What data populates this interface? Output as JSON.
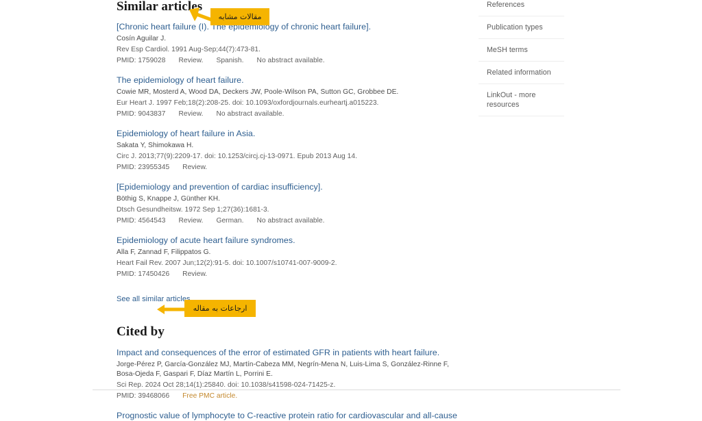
{
  "page": {
    "background": "#ffffff",
    "link_color": "#2c5d8f",
    "accent_color": "#f5b400",
    "free_article_color": "#c3872b"
  },
  "similar_articles": {
    "heading": "Similar articles",
    "see_all_label": "See all similar articles",
    "articles": [
      {
        "title": "[Chronic heart failure (I). The epidemiology of chronic heart failure].",
        "authors": "Cosín Aguilar J.",
        "citation": "Rev Esp Cardiol. 1991 Aug-Sep;44(7):473-81.",
        "pmid": "PMID: 1759028",
        "tags": [
          "Review.",
          "Spanish.",
          "No abstract available."
        ]
      },
      {
        "title": "The epidemiology of heart failure.",
        "authors": "Cowie MR, Mosterd A, Wood DA, Deckers JW, Poole-Wilson PA, Sutton GC, Grobbee DE.",
        "citation": "Eur Heart J. 1997 Feb;18(2):208-25. doi: 10.1093/oxfordjournals.eurheartj.a015223.",
        "pmid": "PMID: 9043837",
        "tags": [
          "Review.",
          "No abstract available."
        ]
      },
      {
        "title": "Epidemiology of heart failure in Asia.",
        "authors": "Sakata Y, Shimokawa H.",
        "citation": "Circ J. 2013;77(9):2209-17. doi: 10.1253/circj.cj-13-0971. Epub 2013 Aug 14.",
        "pmid": "PMID: 23955345",
        "tags": [
          "Review."
        ]
      },
      {
        "title": "[Epidemiology and prevention of cardiac insufficiency].",
        "authors": "Böthig S, Knappe J, Günther KH.",
        "citation": "Dtsch Gesundheitsw. 1972 Sep 1;27(36):1681-3.",
        "pmid": "PMID: 4564543",
        "tags": [
          "Review.",
          "German.",
          "No abstract available."
        ]
      },
      {
        "title": "Epidemiology of acute heart failure syndromes.",
        "authors": "Alla F, Zannad F, Filippatos G.",
        "citation": "Heart Fail Rev. 2007 Jun;12(2):91-5. doi: 10.1007/s10741-007-9009-2.",
        "pmid": "PMID: 17450426",
        "tags": [
          "Review."
        ]
      }
    ]
  },
  "cited_by": {
    "heading": "Cited by",
    "articles": [
      {
        "title": "Impact and consequences of the error of estimated GFR in patients with heart failure.",
        "authors": "Jorge-Pérez P, García-González MJ, Martín-Cabeza MM, Negrín-Mena N, Luis-Lima S, González-Rinne F, Bosa-Ojeda F, Gaspari F, Díaz Martín L, Porrini E.",
        "citation": "Sci Rep. 2024 Oct 28;14(1):25840. doi: 10.1038/s41598-024-71425-z.",
        "pmid": "PMID: 39468066",
        "free_tag": "Free PMC article."
      },
      {
        "title": "Prognostic value of lymphocyte to C-reactive protein ratio for cardiovascular and all-cause",
        "authors": "",
        "citation": "",
        "pmid": "",
        "free_tag": ""
      }
    ]
  },
  "sidebar": {
    "items": [
      {
        "label": "References"
      },
      {
        "label": "Publication types"
      },
      {
        "label": "MeSH terms"
      },
      {
        "label": "Related information"
      },
      {
        "label": "LinkOut - more resources"
      }
    ]
  },
  "annotations": [
    {
      "text": "مقالات مشابه",
      "translation": "similar articles",
      "target": "Similar articles",
      "color": "#f5b400"
    },
    {
      "text": "ارجاعات به مقاله",
      "translation": "citations to the article",
      "target": "Cited by",
      "color": "#f5b400"
    }
  ]
}
